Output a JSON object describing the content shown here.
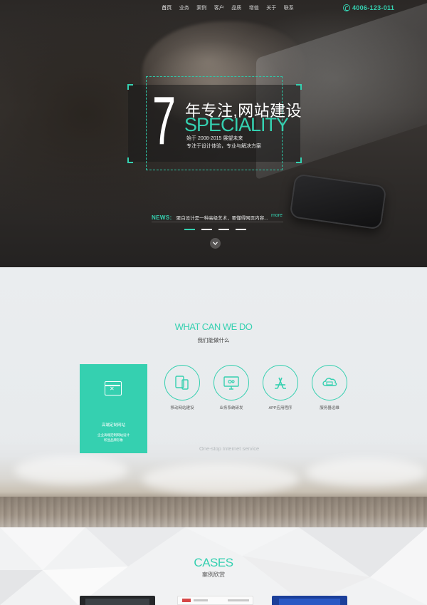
{
  "nav": {
    "items": [
      "首页",
      "业务",
      "案例",
      "客户",
      "品质",
      "增值",
      "关于",
      "联系"
    ],
    "phone": "4006-123-011"
  },
  "hero": {
    "big_number": "7",
    "line1": "年专注,网站建设",
    "line2": "SPECIALITY",
    "line3": "始于 2008-2015 展望未来",
    "line4": "专注于设计体验，专业与解决方案",
    "news_label": "NEWS:",
    "news_text": "聚白设计是一种高级艺术，要懂得网页内容...",
    "more": "more",
    "slides": 4,
    "active_slide": 0
  },
  "services": {
    "title": "WHAT CAN WE DO",
    "subtitle": "我们能做什么",
    "featured": {
      "title": "高端定制网站",
      "desc1": "企业高端定制网站设计",
      "desc2": "彰显品牌形象"
    },
    "items": [
      {
        "label": "移动网站建设",
        "icon": "mobile-devices-icon"
      },
      {
        "label": "业务系统研发",
        "icon": "monitor-code-icon"
      },
      {
        "label": "APP应用程序",
        "icon": "app-store-icon"
      },
      {
        "label": "服务器运维",
        "icon": "cloud-server-icon"
      }
    ],
    "tagline": "One-stop Internet service"
  },
  "cases": {
    "title": "CASES",
    "subtitle": "案例欣赏"
  },
  "colors": {
    "accent": "#35d0b0",
    "hero_bg": "#2e2b29",
    "section_bg": "#e8ebed"
  }
}
